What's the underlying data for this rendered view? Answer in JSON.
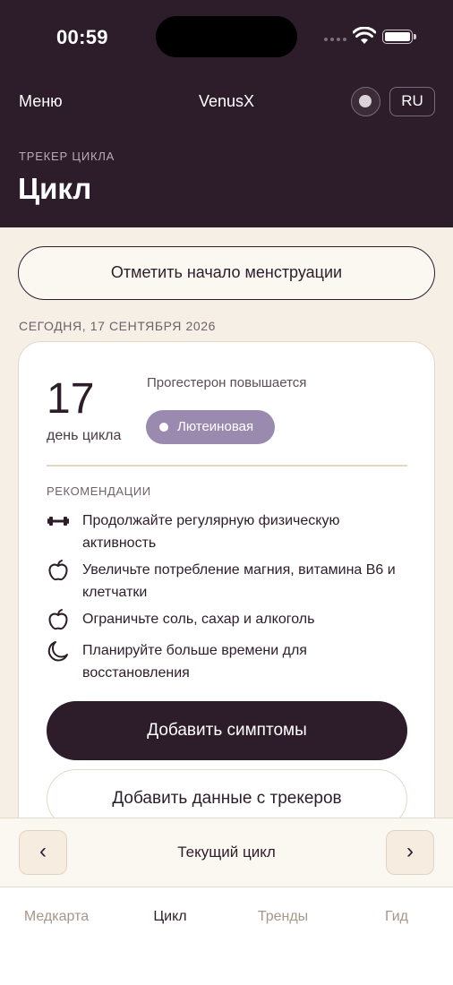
{
  "status_bar": {
    "time": "00:59"
  },
  "nav": {
    "menu_label": "Меню",
    "title": "VenusX",
    "language": "RU"
  },
  "page": {
    "kicker": "ТРЕКЕР ЦИКЛА",
    "title": "Цикл"
  },
  "period_button": "Отметить начало менструации",
  "date_label": "СЕГОДНЯ, 17 СЕНТЯБРЯ 2026",
  "cycle_card": {
    "day_number": "17",
    "day_label": "день цикла",
    "hormone_status": "Прогестерон повышается",
    "phase_label": "Лютеиновая",
    "phase_color": "#9b8aaf",
    "recommendations_title": "РЕКОМЕНДАЦИИ",
    "recommendations": [
      {
        "icon": "dumbbell-icon",
        "text": "Продолжайте регулярную физическую активность"
      },
      {
        "icon": "apple-icon",
        "text": "Увеличьте потребление магния, витамина B6 и клетчатки"
      },
      {
        "icon": "apple-icon",
        "text": "Ограничьте соль, сахар и алкоголь"
      },
      {
        "icon": "moon-icon",
        "text": "Планируйте больше времени для восстановления"
      }
    ],
    "add_symptoms_label": "Добавить симптомы",
    "add_trackers_label": "Добавить данные с трекеров"
  },
  "cycle_nav": {
    "prev": "‹",
    "label": "Текущий цикл",
    "next": "›"
  },
  "tabs": [
    {
      "label": "Медкарта",
      "active": false
    },
    {
      "label": "Цикл",
      "active": true
    },
    {
      "label": "Тренды",
      "active": false
    },
    {
      "label": "Гид",
      "active": false
    }
  ],
  "colors": {
    "brand_dark": "#2d1d2a",
    "background": "#f6efe6",
    "tab_inactive": "#a89689"
  }
}
